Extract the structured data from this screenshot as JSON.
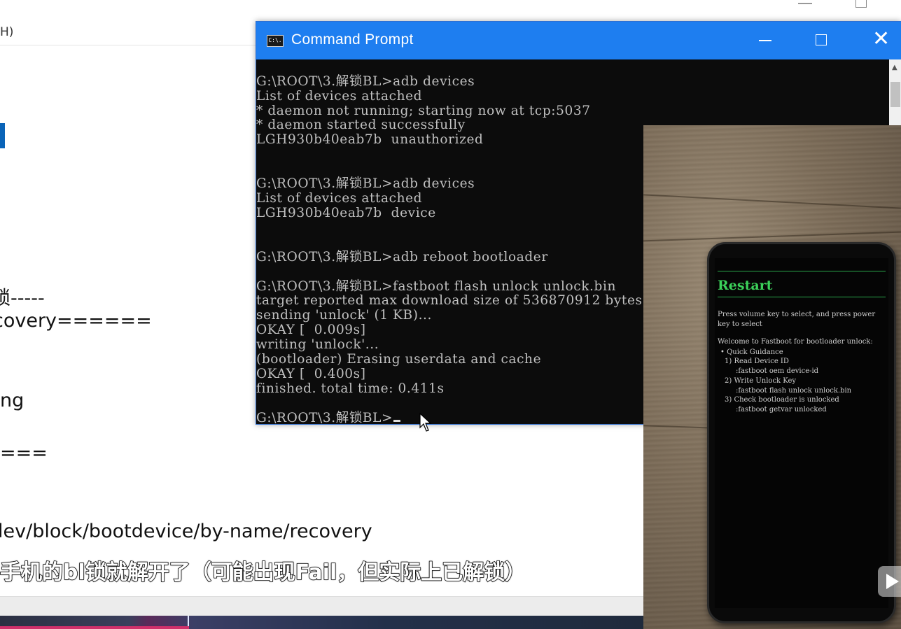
{
  "background_doc": {
    "menu_fragment": "H)",
    "lines": [
      {
        "text": "-----",
        "prefix": "锁"
      },
      {
        "text": "overy======"
      },
      {
        "text": "ng"
      },
      {
        "text": "==="
      },
      {
        "text": "/dev/block/bootdevice/by-name/recovery"
      }
    ],
    "line_texts": {
      "lock_dashes": "锁-----",
      "recovery_eq": "covery======",
      "img_frag": "ng",
      "eq3": "===",
      "dev_path": "lev/block/bootdevice/by-name/recovery"
    }
  },
  "subtitle": "手机的bl锁就解开了（可能出现Fail，但实际上已解锁）",
  "cmd": {
    "title": "Command Prompt",
    "icon_text": "C:\\.",
    "console_lines": [
      "G:\\ROOT\\3.解锁BL>adb devices",
      "List of devices attached",
      "* daemon not running; starting now at tcp:5037",
      "* daemon started successfully",
      "LGH930b40eab7b  unauthorized",
      "",
      "",
      "G:\\ROOT\\3.解锁BL>adb devices",
      "List of devices attached",
      "LGH930b40eab7b  device",
      "",
      "",
      "G:\\ROOT\\3.解锁BL>adb reboot bootloader",
      "",
      "G:\\ROOT\\3.解锁BL>fastboot flash unlock unlock.bin",
      "target reported max download size of 536870912 bytes",
      "sending 'unlock' (1 KB)...",
      "OKAY [  0.009s]",
      "writing 'unlock'...",
      "(bootloader) Erasing userdata and cache",
      "OKAY [  0.400s]",
      "finished. total time: 0.411s",
      "",
      "G:\\ROOT\\3.解锁BL>"
    ]
  },
  "phone": {
    "title": "Restart",
    "instructions_1": "Press volume key to select, and press power",
    "instructions_2": "key to select",
    "welcome": "Welcome to Fastboot for bootloader unlock:",
    "quick": "• Quick Guidance",
    "item1": "1) Read Device ID",
    "item1_cmd": ":fastboot oem device-id",
    "item2": "2) Write Unlock Key",
    "item2_cmd": ":fastboot flash unlock unlock.bin",
    "item3": "3) Check bootloader is unlocked",
    "item3_cmd": ":fastboot getvar unlocked"
  },
  "colors": {
    "titlebar": "#1e7ef0",
    "console_bg": "#0c0c0c",
    "console_text": "#c0c0c0",
    "phone_green": "#3bd15a"
  }
}
